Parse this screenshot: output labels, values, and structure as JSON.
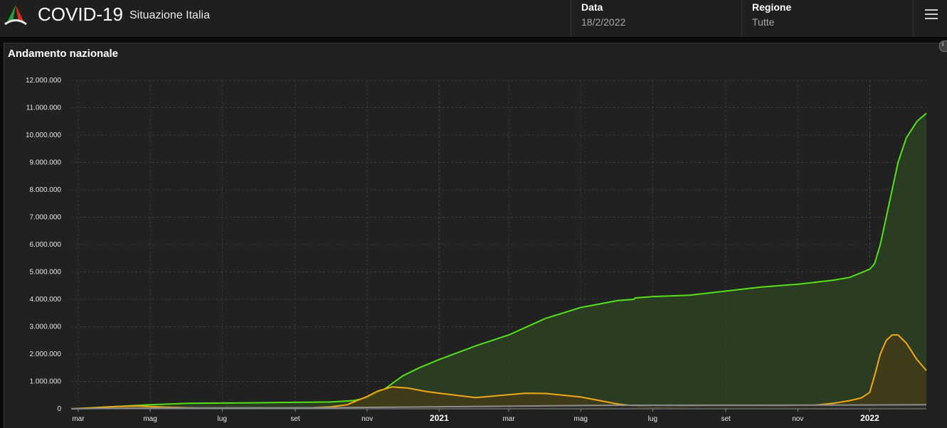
{
  "header": {
    "title": "COVID-19",
    "subtitle": "Situazione Italia",
    "date_label": "Data",
    "date_value": "18/2/2022",
    "region_label": "Regione",
    "region_value": "Tutte"
  },
  "panel": {
    "title": "Andamento nazionale"
  },
  "chart_data": {
    "type": "area",
    "title": "Andamento nazionale",
    "xlabel": "",
    "ylabel": "",
    "ylim": [
      0,
      12000000
    ],
    "yticks": [
      0,
      1000000,
      2000000,
      3000000,
      4000000,
      5000000,
      6000000,
      7000000,
      8000000,
      9000000,
      10000000,
      11000000,
      12000000
    ],
    "ytick_labels": [
      "0",
      "1.000.000",
      "2.000.000",
      "3.000.000",
      "4.000.000",
      "5.000.000",
      "6.000.000",
      "7.000.000",
      "8.000.000",
      "9.000.000",
      "10.000.000",
      "11.000.000",
      "12.000.000"
    ],
    "xlim": [
      "2020-02-24",
      "2022-02-18"
    ],
    "xticks": [
      {
        "date": "2020-03-01",
        "label": "mar",
        "year": false
      },
      {
        "date": "2020-05-01",
        "label": "mag",
        "year": false
      },
      {
        "date": "2020-07-01",
        "label": "lug",
        "year": false
      },
      {
        "date": "2020-09-01",
        "label": "set",
        "year": false
      },
      {
        "date": "2020-11-01",
        "label": "nov",
        "year": false
      },
      {
        "date": "2021-01-01",
        "label": "2021",
        "year": true
      },
      {
        "date": "2021-03-01",
        "label": "mar",
        "year": false
      },
      {
        "date": "2021-05-01",
        "label": "mag",
        "year": false
      },
      {
        "date": "2021-07-01",
        "label": "lug",
        "year": false
      },
      {
        "date": "2021-09-01",
        "label": "set",
        "year": false
      },
      {
        "date": "2021-11-01",
        "label": "nov",
        "year": false
      },
      {
        "date": "2022-01-01",
        "label": "2022",
        "year": true
      }
    ],
    "grid": true,
    "series": [
      {
        "color": "#55e01a",
        "fill": "#2b4121",
        "x": [
          "2020-02-24",
          "2020-04-01",
          "2020-05-01",
          "2020-06-01",
          "2020-08-01",
          "2020-10-01",
          "2020-10-20",
          "2020-11-01",
          "2020-11-15",
          "2020-12-01",
          "2020-12-15",
          "2021-01-01",
          "2021-02-01",
          "2021-03-01",
          "2021-04-01",
          "2021-05-01",
          "2021-06-01",
          "2021-06-15",
          "2021-06-16",
          "2021-07-01",
          "2021-08-01",
          "2021-09-01",
          "2021-10-01",
          "2021-11-01",
          "2021-12-01",
          "2021-12-15",
          "2022-01-01",
          "2022-01-05",
          "2022-01-10",
          "2022-01-15",
          "2022-01-20",
          "2022-01-25",
          "2022-02-01",
          "2022-02-10",
          "2022-02-18"
        ],
        "y": [
          0,
          80000,
          150000,
          200000,
          220000,
          250000,
          300000,
          400000,
          700000,
          1200000,
          1500000,
          1800000,
          2300000,
          2700000,
          3300000,
          3700000,
          3950000,
          4000000,
          4050000,
          4100000,
          4150000,
          4300000,
          4450000,
          4550000,
          4700000,
          4800000,
          5100000,
          5300000,
          6000000,
          7000000,
          8000000,
          9000000,
          9900000,
          10500000,
          10800000
        ]
      },
      {
        "color": "#f0a818",
        "fill": "#433b16",
        "x": [
          "2020-02-24",
          "2020-03-15",
          "2020-04-01",
          "2020-04-20",
          "2020-05-15",
          "2020-06-15",
          "2020-08-01",
          "2020-09-15",
          "2020-10-01",
          "2020-10-15",
          "2020-11-01",
          "2020-11-10",
          "2020-11-22",
          "2020-12-05",
          "2020-12-20",
          "2021-01-01",
          "2021-02-01",
          "2021-02-25",
          "2021-03-15",
          "2021-04-01",
          "2021-05-01",
          "2021-06-01",
          "2021-06-20",
          "2021-07-01",
          "2021-07-15",
          "2021-08-15",
          "2021-09-15",
          "2021-10-15",
          "2021-11-15",
          "2021-12-01",
          "2021-12-15",
          "2021-12-25",
          "2022-01-01",
          "2022-01-05",
          "2022-01-10",
          "2022-01-15",
          "2022-01-20",
          "2022-01-25",
          "2022-02-01",
          "2022-02-10",
          "2022-02-18"
        ],
        "y": [
          0,
          40000,
          80000,
          105000,
          60000,
          20000,
          15000,
          40000,
          70000,
          150000,
          450000,
          650000,
          800000,
          760000,
          640000,
          570000,
          410000,
          500000,
          570000,
          560000,
          430000,
          180000,
          80000,
          50000,
          60000,
          110000,
          115000,
          100000,
          130000,
          200000,
          300000,
          400000,
          600000,
          1200000,
          2000000,
          2500000,
          2700000,
          2700000,
          2400000,
          1800000,
          1400000
        ]
      },
      {
        "color": "#8c8c8c",
        "fill": "#2c2c2c",
        "x": [
          "2020-02-24",
          "2020-04-01",
          "2020-06-01",
          "2020-10-01",
          "2021-01-01",
          "2021-04-01",
          "2021-06-01",
          "2021-10-01",
          "2022-01-01",
          "2022-02-18"
        ],
        "y": [
          0,
          20000,
          35000,
          40000,
          75000,
          110000,
          130000,
          132000,
          140000,
          150000
        ]
      }
    ]
  }
}
